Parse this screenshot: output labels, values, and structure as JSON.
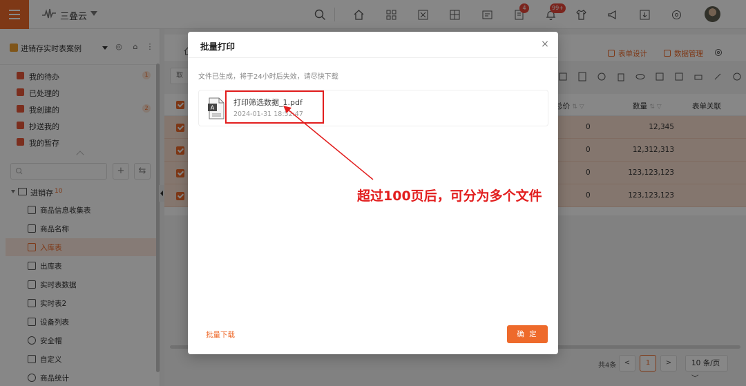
{
  "topbar": {
    "app_name": "三叠云",
    "badges": {
      "tasks": "4",
      "notifications": "99+"
    },
    "colors": {
      "accent": "#ee6a2b",
      "badge": "#e8463a"
    }
  },
  "sidebar": {
    "app_title": "进销存实时表案例",
    "quick_items": [
      {
        "label": "我的待办",
        "count": "1",
        "color": "#e8573a"
      },
      {
        "label": "已处理的",
        "count": "",
        "color": "#e8573a"
      },
      {
        "label": "我创建的",
        "count": "2",
        "color": "#e8573a"
      },
      {
        "label": "抄送我的",
        "count": "",
        "color": "#e8573a"
      },
      {
        "label": "我的暂存",
        "count": "",
        "color": "#e8573a"
      }
    ],
    "search_placeholder": "",
    "add_symbol": "+",
    "swap_symbol": "⇆",
    "tree_root": {
      "label": "进销存",
      "count": "10"
    },
    "tree_items": [
      {
        "label": "商品信息收集表"
      },
      {
        "label": "商品名称"
      },
      {
        "label": "入库表"
      },
      {
        "label": "出库表"
      },
      {
        "label": "实时表数据"
      },
      {
        "label": "实时表2"
      },
      {
        "label": "设备列表"
      },
      {
        "label": "安全帽"
      },
      {
        "label": "自定义"
      },
      {
        "label": "商品统计"
      }
    ],
    "active_index": 2
  },
  "main": {
    "header_links": {
      "form_design": "表单设计",
      "data_manage": "数据管理"
    },
    "toolbar_btn_partial": "取",
    "grid": {
      "col_price": "总价",
      "col_qty": "数量",
      "col_rel": "表单关联",
      "rows": [
        {
          "price": "0",
          "qty": "12,345"
        },
        {
          "price": "0",
          "qty": "12,312,313"
        },
        {
          "price": "0",
          "qty": "123,123,123"
        },
        {
          "price": "0",
          "qty": "123,123,123"
        }
      ]
    },
    "pager": {
      "total": "共4条",
      "prev": "<",
      "current": "1",
      "next": ">",
      "size": "10 条/页"
    }
  },
  "modal": {
    "title": "批量打印",
    "close": "×",
    "hint": "文件已生成，将于24小时后失效，请尽快下载",
    "file": {
      "name": "打印筛选数据_1.pdf",
      "time": "2024-01-31 18:52:47"
    },
    "batch_download": "批量下载",
    "confirm": "确 定"
  },
  "annotation": {
    "text": "超过100页后，可分为多个文件",
    "color": "#e21d1d"
  }
}
